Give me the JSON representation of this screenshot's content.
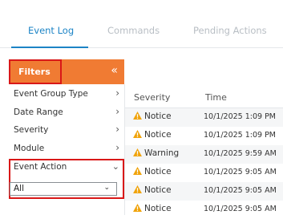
{
  "tabs": [
    {
      "label": "Event Log",
      "active": true
    },
    {
      "label": "Commands",
      "active": false
    },
    {
      "label": "Pending Actions",
      "active": false
    }
  ],
  "filters": {
    "title": "Filters",
    "collapse_icon": "«",
    "items": [
      {
        "label": "Event Group Type",
        "icon": "chevron-right-icon"
      },
      {
        "label": "Date Range",
        "icon": "chevron-right-icon"
      },
      {
        "label": "Severity",
        "icon": "chevron-right-icon"
      },
      {
        "label": "Module",
        "icon": "chevron-right-icon"
      }
    ],
    "event_action": {
      "label": "Event Action",
      "icon": "chevron-down-icon",
      "selected": "All"
    }
  },
  "grid": {
    "columns": [
      "Severity",
      "Time"
    ],
    "rows": [
      {
        "severity": "Notice",
        "time": "10/1/2025 1:09 PM"
      },
      {
        "severity": "Notice",
        "time": "10/1/2025 1:09 PM"
      },
      {
        "severity": "Warning",
        "time": "10/1/2025 9:59 AM"
      },
      {
        "severity": "Notice",
        "time": "10/1/2025 9:05 AM"
      },
      {
        "severity": "Notice",
        "time": "10/1/2025 9:05 AM"
      },
      {
        "severity": "Notice",
        "time": "10/1/2025 9:05 AM"
      }
    ]
  },
  "colors": {
    "accent": "#1c84c6",
    "filters_header": "#f07b33",
    "highlight_border": "#d91818",
    "warning": "#f0a30a"
  }
}
